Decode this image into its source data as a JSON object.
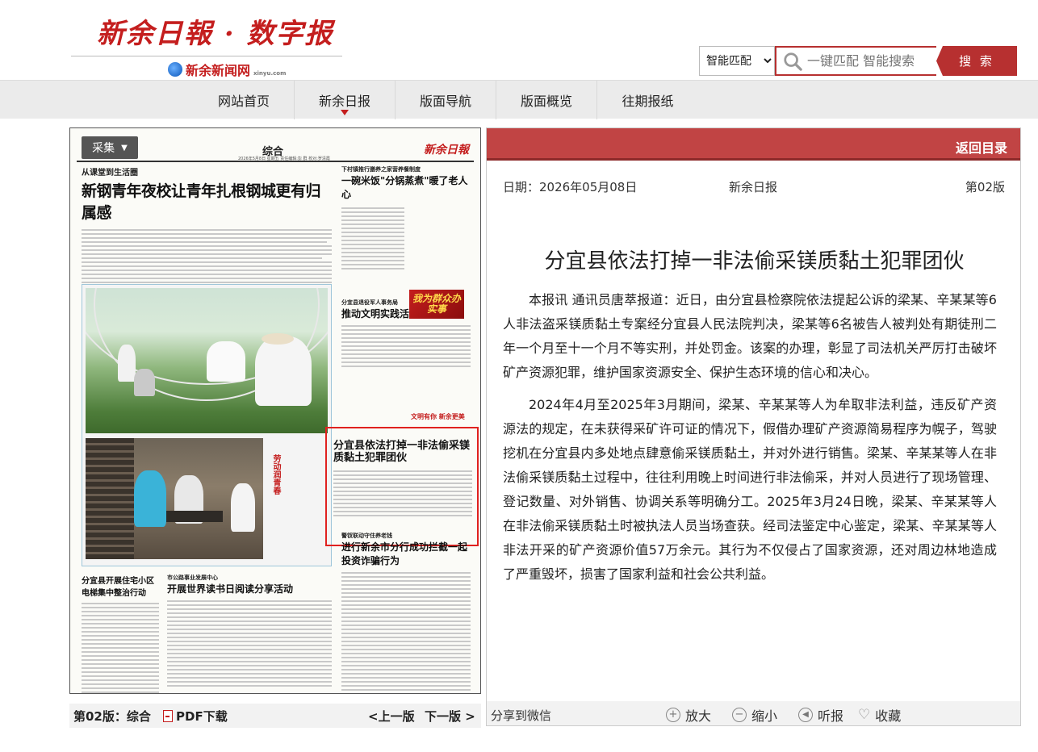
{
  "site": {
    "logo_main": "新余日報 · 数字报",
    "logo_sub": "新余新闻网",
    "logo_sub_domain": "xinyu.com"
  },
  "search": {
    "mode_selected": "智能匹配",
    "placeholder": "一键匹配 智能搜索",
    "button": "搜 索"
  },
  "nav": {
    "items": [
      "网站首页",
      "新余日报",
      "版面导航",
      "版面概览",
      "往期报纸"
    ]
  },
  "paper": {
    "collect_label": "采集",
    "section": "综合",
    "masthead": "新余日報",
    "date_strip": "2026年5月8日 星期五 责任编辑:彭 群 校对:罗清霞",
    "kicker1": "从课堂到生活圈",
    "headline1": "新钢青年夜校让青年扎根钢城更有归属感",
    "kicker2": "下村镇推行膳养之家营养餐制度",
    "headline2": "一碗米饭\"分锅蒸煮\"暖了老人心",
    "badge": "我为群众办实事",
    "kicker3": "分宜县退役军人事务局",
    "headline3": "推动文明实践活动深入开展",
    "ribbon": "文明有你 新余更美",
    "highlight_title": "分宜县依法打掉一非法偷采镁质黏土犯罪团伙",
    "photo_caption": "劳动润青春",
    "kicker4": "警钗联动守住养老钱",
    "headline4": "进行新余市分行成功拦截一起投资诈骗行为",
    "bottom_left_title": "分宜县开展住宅小区电梯集中整治行动",
    "bottom_mid_kicker": "市公路事业发展中心",
    "bottom_mid_title": "开展世界读书日阅读分享活动"
  },
  "left_bar": {
    "page_label": "第02版：综合",
    "pdf_label": "PDF下载",
    "prev": "<上一版",
    "next": "下一版 >"
  },
  "article": {
    "back": "返回目录",
    "date": "日期：2026年05月08日",
    "paper_name": "新余日报",
    "page_no": "第02版",
    "title": "分宜县依法打掉一非法偷采镁质黏土犯罪团伙",
    "paragraphs": [
      "本报讯 通讯员唐萃报道：近日，由分宜县检察院依法提起公诉的梁某、辛某某等6人非法盗采镁质黏土专案经分宜县人民法院判决，梁某等6名被告人被判处有期徒刑二年一个月至十一个月不等实刑，并处罚金。该案的办理，彰显了司法机关严厉打击破坏矿产资源犯罪，维护国家资源安全、保护生态环境的信心和决心。",
      "2024年4月至2025年3月期间，梁某、辛某某等人为牟取非法利益，违反矿产资源法的规定，在未获得采矿许可证的情况下，假借办理矿产资源简易程序为幌子，驾驶挖机在分宜县内多处地点肆意偷采镁质黏土，并对外进行销售。梁某、辛某某等人在非法偷采镁质黏土过程中，往往利用晚上时间进行非法偷采，并对人员进行了现场管理、登记数量、对外销售、协调关系等明确分工。2025年3月24日晚，梁某、辛某某等人在非法偷采镁质黏土时被执法人员当场查获。经司法鉴定中心鉴定，梁某、辛某某等人非法开采的矿产资源价值57万余元。其行为不仅侵占了国家资源，还对周边林地造成了严重毁坏，损害了国家利益和社会公共利益。"
    ]
  },
  "right_bar": {
    "share": "分享到微信",
    "zoom_in": "放大",
    "zoom_out": "缩小",
    "listen": "听报",
    "favorite": "收藏"
  },
  "colors": {
    "brand_red": "#c41e1e",
    "header_red": "#c14444",
    "search_red": "#b73030"
  }
}
